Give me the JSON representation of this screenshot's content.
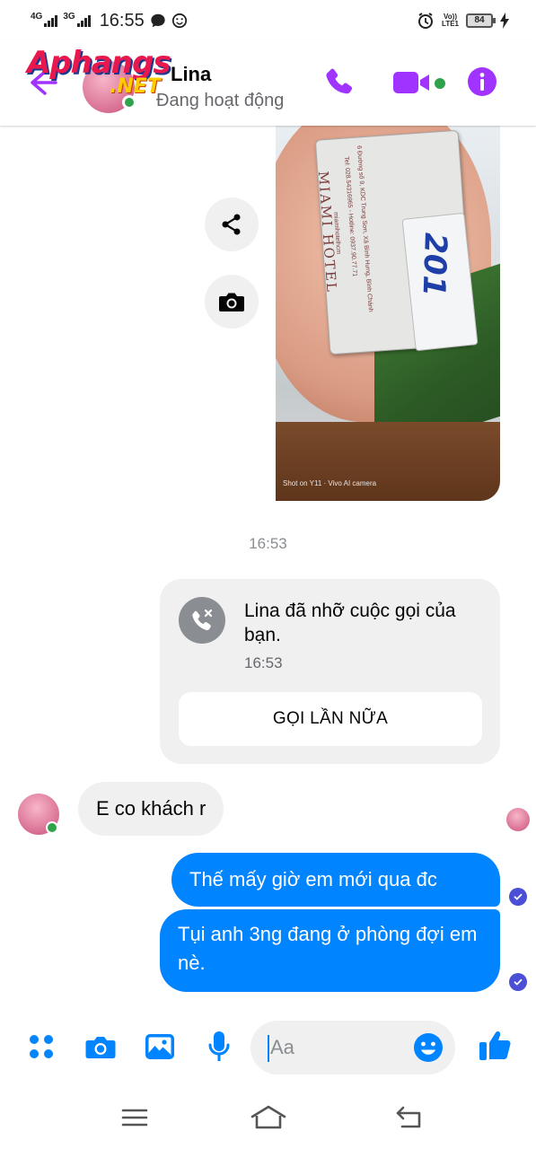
{
  "status_bar": {
    "net1": "4G",
    "net2": "3G",
    "time": "16:55",
    "volte_top": "Vo))",
    "volte_bottom": "LTE1",
    "battery": "84"
  },
  "header": {
    "contact_name": "Lina",
    "status": "Đang hoạt động",
    "logo_text_1": "Aphangs",
    "logo_text_2": ".NET"
  },
  "photo": {
    "card_title": "MIAMI HOTEL",
    "card_line_1": "6 Đường số 9, KDC Trung Sơn, Xã Bình Hưng, Bình Chánh",
    "card_line_2": "Tel: 028.54316965 - Hotline: 0937.90.77.71",
    "card_line_3": "miamihotelhcm",
    "room_number": "201",
    "watermark": "Shot on Y11 · Vivo AI camera"
  },
  "messages": {
    "timestamp": "16:53",
    "missed_call_text": "Lina đã nhỡ cuộc gọi của bạn.",
    "missed_call_time": "16:53",
    "call_again_label": "GỌI LẦN NỮA",
    "incoming_1": "E co khách r",
    "outgoing_1": "Thế mấy giờ em mới qua đc",
    "outgoing_2": "Tụi anh 3ng đang ở phòng đợi em nè."
  },
  "composer": {
    "placeholder": "Aa"
  },
  "colors": {
    "accent": "#a033ff",
    "bubble_out": "#0084ff",
    "online": "#31a24c"
  }
}
